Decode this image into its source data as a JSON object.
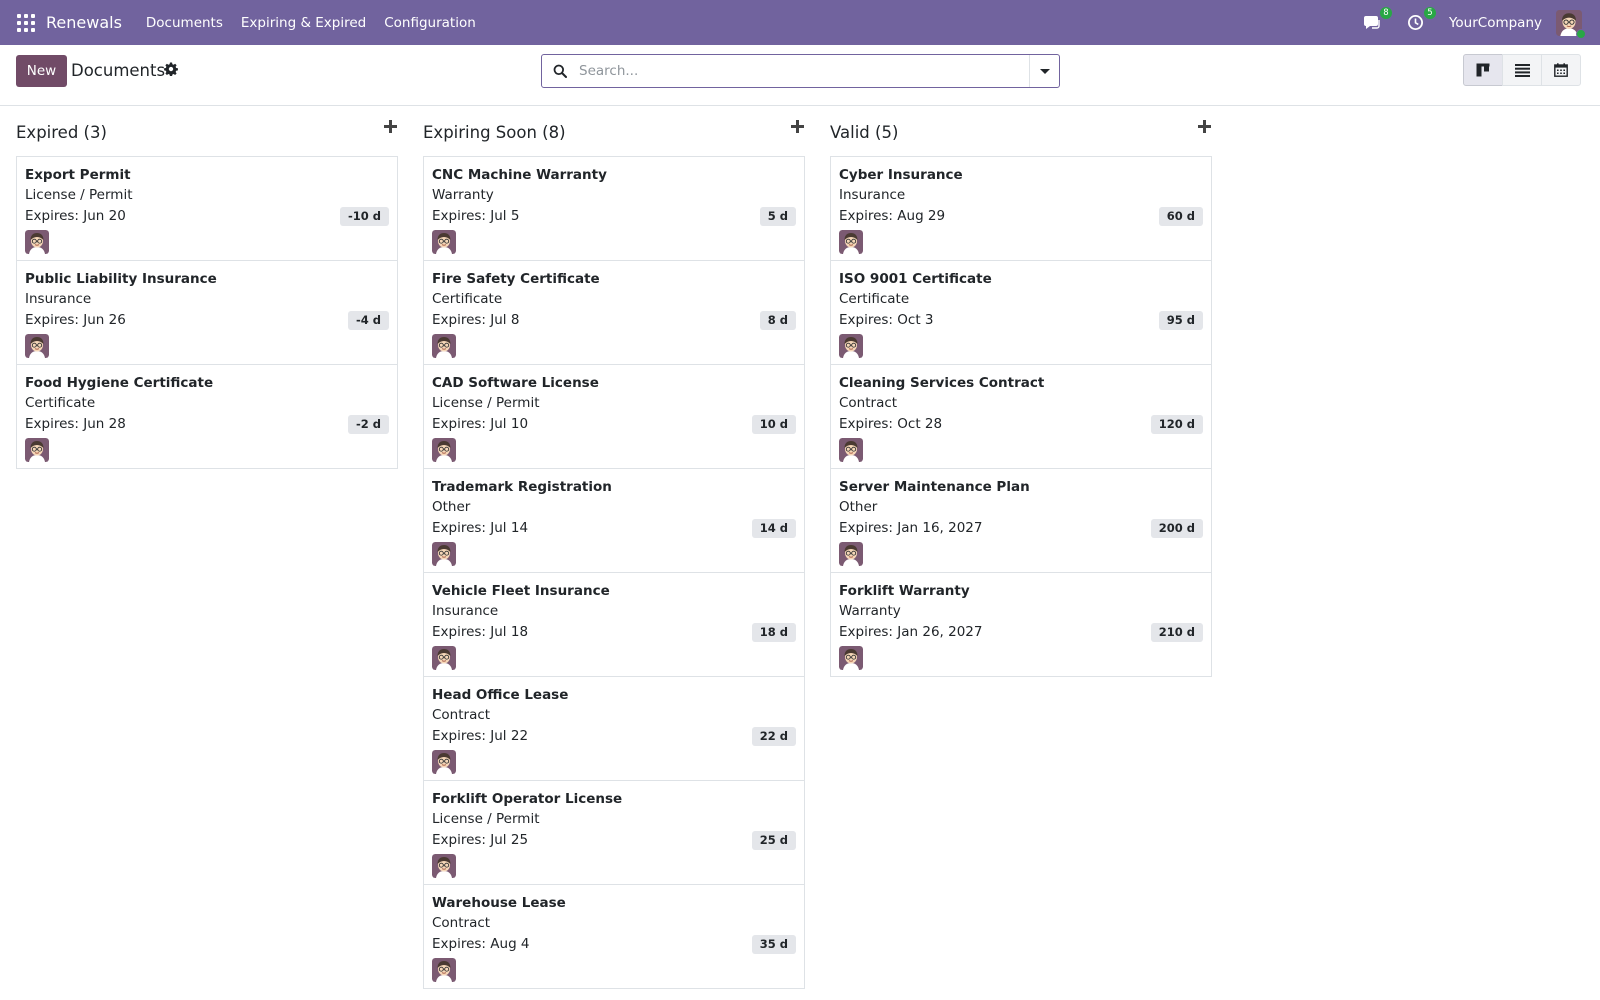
{
  "navbar": {
    "brand": "Renewals",
    "menu": [
      "Documents",
      "Expiring & Expired",
      "Configuration"
    ],
    "messages_count": "8",
    "activities_count": "5",
    "company": "YourCompany"
  },
  "control_panel": {
    "new_label": "New",
    "title": "Documents",
    "search_placeholder": "Search..."
  },
  "kanban": {
    "columns": [
      {
        "title": "Expired (3)",
        "cards": [
          {
            "name": "Export Permit",
            "type": "License / Permit",
            "expires": "Expires: Jun 20",
            "days": "-10 d"
          },
          {
            "name": "Public Liability Insurance",
            "type": "Insurance",
            "expires": "Expires: Jun 26",
            "days": "-4 d"
          },
          {
            "name": "Food Hygiene Certificate",
            "type": "Certificate",
            "expires": "Expires: Jun 28",
            "days": "-2 d"
          }
        ]
      },
      {
        "title": "Expiring Soon (8)",
        "cards": [
          {
            "name": "CNC Machine Warranty",
            "type": "Warranty",
            "expires": "Expires: Jul 5",
            "days": "5 d"
          },
          {
            "name": "Fire Safety Certificate",
            "type": "Certificate",
            "expires": "Expires: Jul 8",
            "days": "8 d"
          },
          {
            "name": "CAD Software License",
            "type": "License / Permit",
            "expires": "Expires: Jul 10",
            "days": "10 d"
          },
          {
            "name": "Trademark Registration",
            "type": "Other",
            "expires": "Expires: Jul 14",
            "days": "14 d"
          },
          {
            "name": "Vehicle Fleet Insurance",
            "type": "Insurance",
            "expires": "Expires: Jul 18",
            "days": "18 d"
          },
          {
            "name": "Head Office Lease",
            "type": "Contract",
            "expires": "Expires: Jul 22",
            "days": "22 d"
          },
          {
            "name": "Forklift Operator License",
            "type": "License / Permit",
            "expires": "Expires: Jul 25",
            "days": "25 d"
          },
          {
            "name": "Warehouse Lease",
            "type": "Contract",
            "expires": "Expires: Aug 4",
            "days": "35 d"
          }
        ]
      },
      {
        "title": "Valid (5)",
        "cards": [
          {
            "name": "Cyber Insurance",
            "type": "Insurance",
            "expires": "Expires: Aug 29",
            "days": "60 d"
          },
          {
            "name": "ISO 9001 Certificate",
            "type": "Certificate",
            "expires": "Expires: Oct 3",
            "days": "95 d"
          },
          {
            "name": "Cleaning Services Contract",
            "type": "Contract",
            "expires": "Expires: Oct 28",
            "days": "120 d"
          },
          {
            "name": "Server Maintenance Plan",
            "type": "Other",
            "expires": "Expires: Jan 16, 2027",
            "days": "200 d"
          },
          {
            "name": "Forklift Warranty",
            "type": "Warranty",
            "expires": "Expires: Jan 26, 2027",
            "days": "210 d"
          }
        ]
      }
    ]
  },
  "colors": {
    "navbar": "#71639e",
    "primary_button": "#714b67",
    "badge_bg": "#e4e6ea",
    "border": "#dee2e6"
  },
  "icons": {
    "apps": "apps-grid-icon",
    "messages": "chat-bubble-icon",
    "activities": "clock-icon",
    "settings": "gear-icon",
    "search": "search-icon",
    "kanban_view": "kanban-view-icon",
    "list_view": "list-view-icon",
    "calendar_view": "calendar-view-icon",
    "quick_create": "plus-icon",
    "avatar": "user-avatar-icon"
  }
}
